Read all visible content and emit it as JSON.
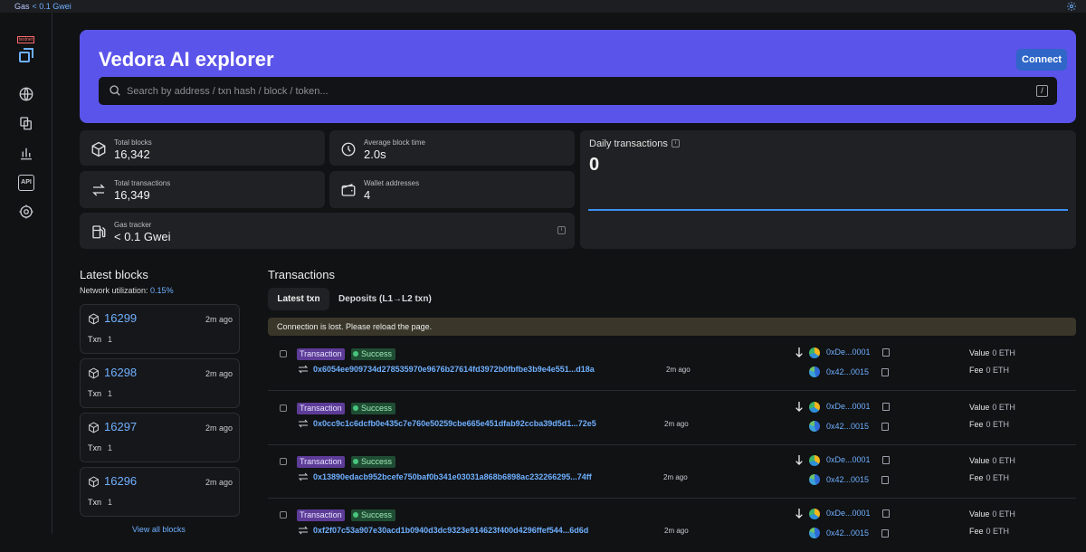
{
  "topbar": {
    "gas_label": "Gas",
    "gas_value": "< 0.1 Gwei"
  },
  "sidebar": {
    "badge": "testnet",
    "api_label": "API"
  },
  "hero": {
    "title": "Vedora AI explorer",
    "connect_label": "Connect",
    "search_placeholder": "Search by address / txn hash / block / token...",
    "search_shortcut": "/"
  },
  "stats": {
    "total_blocks": {
      "label": "Total blocks",
      "value": "16,342"
    },
    "avg_block_time": {
      "label": "Average block time",
      "value": "2.0s"
    },
    "total_transactions": {
      "label": "Total transactions",
      "value": "16,349"
    },
    "wallet_addresses": {
      "label": "Wallet addresses",
      "value": "4"
    },
    "gas_tracker": {
      "label": "Gas tracker",
      "value": "< 0.1 Gwei"
    }
  },
  "daily": {
    "title": "Daily transactions",
    "value": "0"
  },
  "latest_blocks": {
    "title": "Latest blocks",
    "util_label": "Network utilization:",
    "util_value": "0.15%",
    "items": [
      {
        "number": "16299",
        "age": "2m ago",
        "txn_label": "Txn",
        "txn_count": "1"
      },
      {
        "number": "16298",
        "age": "2m ago",
        "txn_label": "Txn",
        "txn_count": "1"
      },
      {
        "number": "16297",
        "age": "2m ago",
        "txn_label": "Txn",
        "txn_count": "1"
      },
      {
        "number": "16296",
        "age": "2m ago",
        "txn_label": "Txn",
        "txn_count": "1"
      }
    ],
    "view_all": "View all blocks"
  },
  "transactions": {
    "title": "Transactions",
    "tabs": [
      "Latest txn",
      "Deposits (L1→L2 txn)"
    ],
    "alert": "Connection is lost. Please reload the page.",
    "items": [
      {
        "type": "Transaction",
        "status": "Success",
        "hash": "0x6054ee909734d278535970e9676b27614fd3972b0fbfbe3b9e4e551...d18a",
        "age": "2m ago",
        "from": "0xDe...0001",
        "to": "0x42...0015",
        "value_label": "Value",
        "value": "0 ETH",
        "fee_label": "Fee",
        "fee": "0 ETH"
      },
      {
        "type": "Transaction",
        "status": "Success",
        "hash": "0x0cc9c1c6dcfb0e435c7e760e50259cbe665e451dfab92ccba39d5d1...72e5",
        "age": "2m ago",
        "from": "0xDe...0001",
        "to": "0x42...0015",
        "value_label": "Value",
        "value": "0 ETH",
        "fee_label": "Fee",
        "fee": "0 ETH"
      },
      {
        "type": "Transaction",
        "status": "Success",
        "hash": "0x13890edacb952bcefe750baf0b341e03031a868b6898ac232266295...74ff",
        "age": "2m ago",
        "from": "0xDe...0001",
        "to": "0x42...0015",
        "value_label": "Value",
        "value": "0 ETH",
        "fee_label": "Fee",
        "fee": "0 ETH"
      },
      {
        "type": "Transaction",
        "status": "Success",
        "hash": "0xf2f07c53a907e30acd1b0940d3dc9323e914623f400d4296ffef544...6d6d",
        "age": "2m ago",
        "from": "0xDe...0001",
        "to": "0x42...0015",
        "value_label": "Value",
        "value": "0 ETH",
        "fee_label": "Fee",
        "fee": "0 ETH"
      }
    ]
  }
}
